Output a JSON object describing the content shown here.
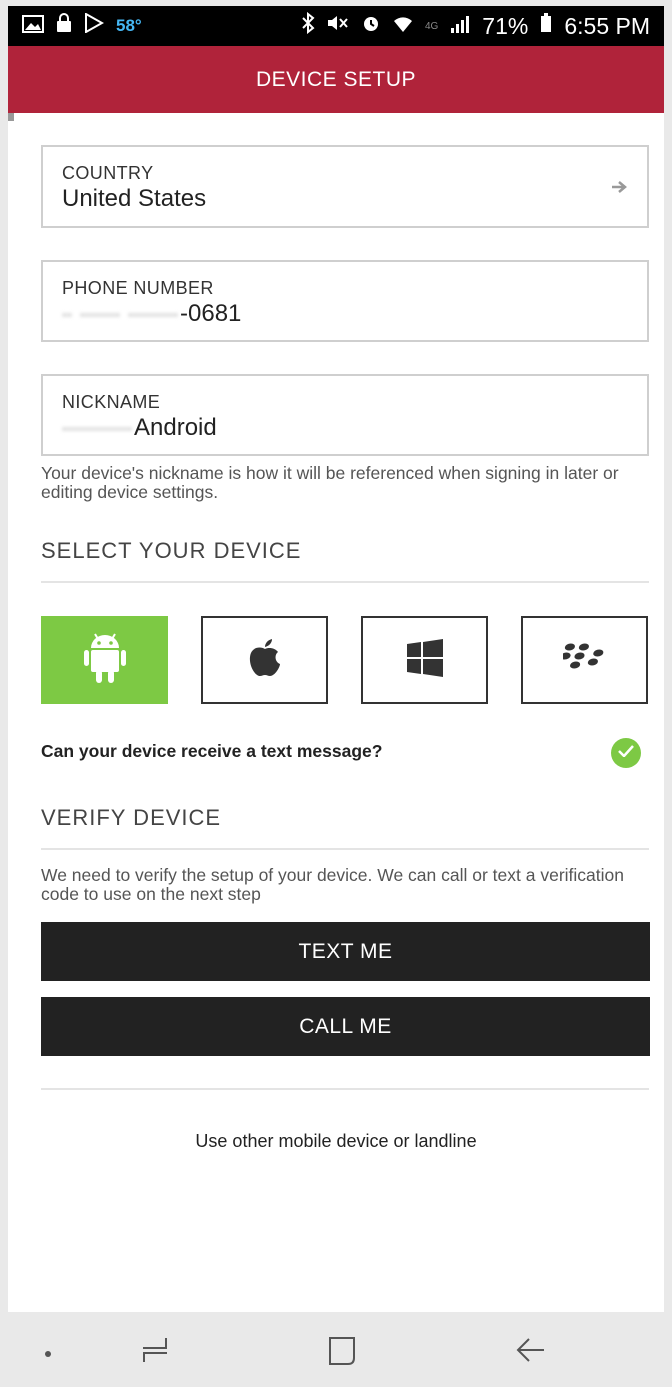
{
  "status_bar": {
    "temperature": "58°",
    "battery_percent": "71%",
    "time": "6:55 PM",
    "network": "4G",
    "icons_left": [
      "image-icon",
      "lock-icon",
      "play-store-icon"
    ],
    "icons_right": [
      "bluetooth-icon",
      "mute-icon",
      "alarm-icon",
      "wifi-icon",
      "signal-icon",
      "battery-icon"
    ]
  },
  "app_bar": {
    "title": "DEVICE SETUP"
  },
  "form": {
    "country": {
      "label": "COUNTRY",
      "value": "United States"
    },
    "phone": {
      "label": "PHONE NUMBER",
      "value": "-0681"
    },
    "nickname": {
      "label": "NICKNAME",
      "value": "Android"
    },
    "nickname_help": "Your device's nickname is how it will be referenced when signing in later or editing device settings."
  },
  "select_device": {
    "title": "SELECT YOUR DEVICE",
    "options": [
      {
        "name": "Android",
        "icon": "android-icon",
        "selected": true
      },
      {
        "name": "Apple",
        "icon": "apple-icon",
        "selected": false
      },
      {
        "name": "Windows",
        "icon": "windows-icon",
        "selected": false
      },
      {
        "name": "BlackBerry",
        "icon": "blackberry-icon",
        "selected": false
      }
    ],
    "text_question": "Can your device receive a text message?",
    "text_capable": true
  },
  "verify": {
    "title": "VERIFY DEVICE",
    "description": "We need to verify the setup of your device. We can call or text a verification code to use on the next step",
    "text_button": "TEXT ME",
    "call_button": "CALL ME",
    "other_link": "Use other mobile device or landline"
  },
  "colors": {
    "brand": "#b0233a",
    "android_green": "#7dc944",
    "button_dark": "#222222"
  }
}
